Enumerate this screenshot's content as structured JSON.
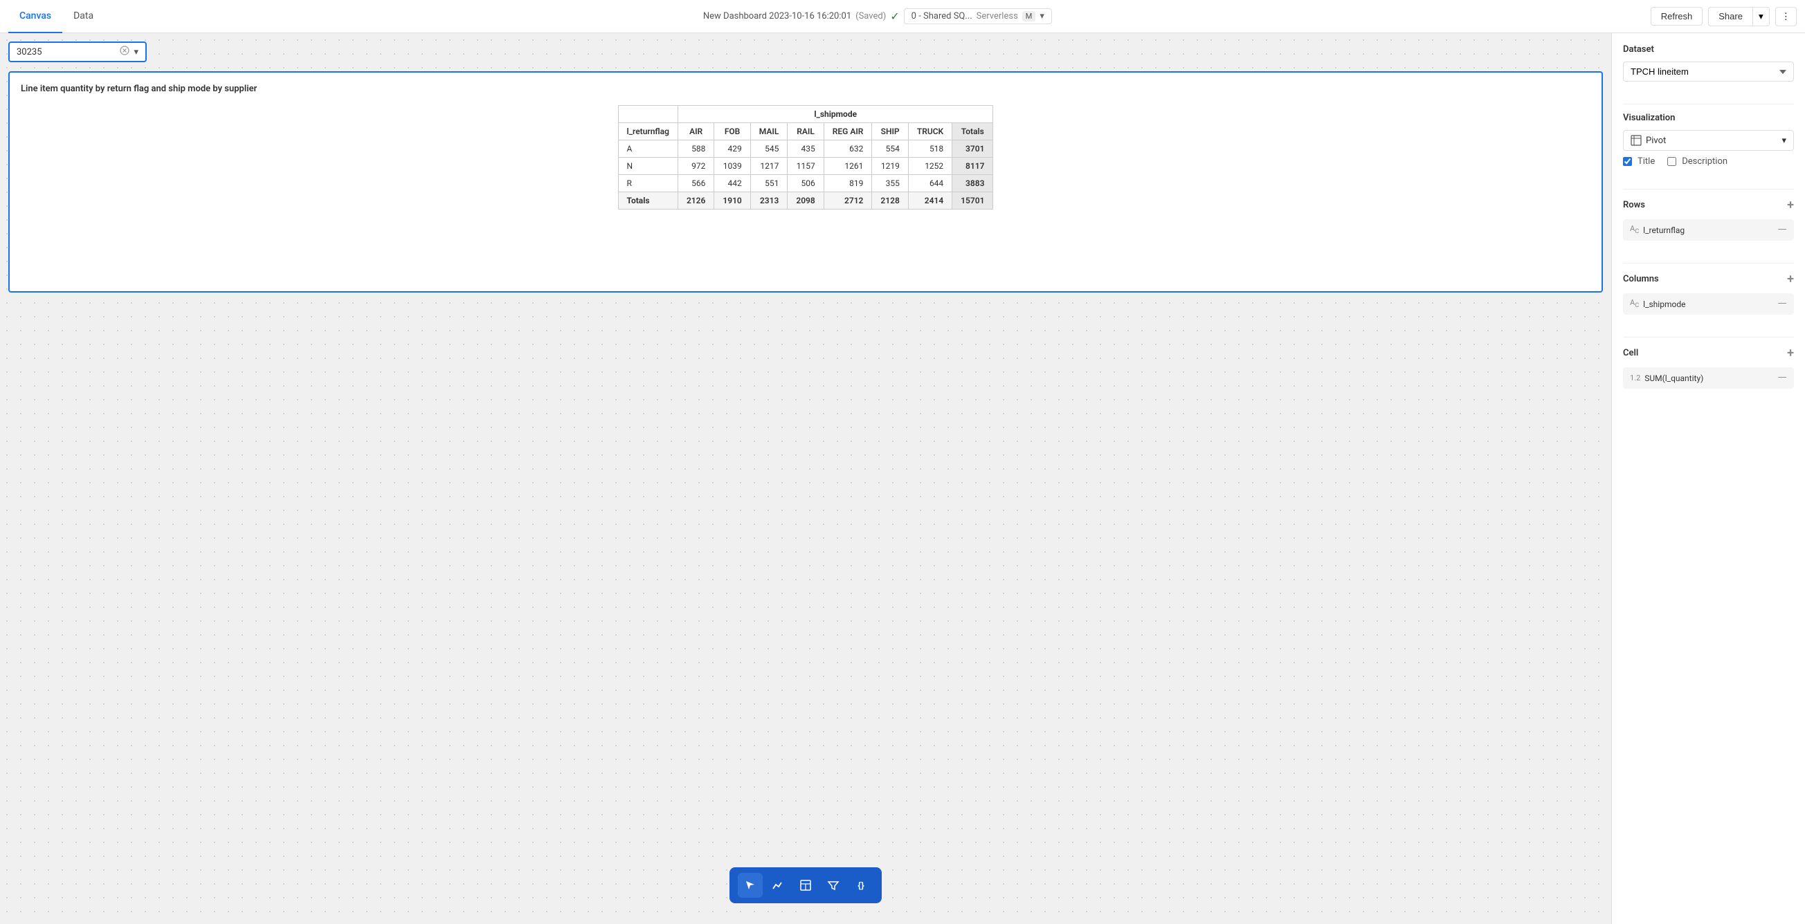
{
  "topbar": {
    "tabs": [
      {
        "id": "canvas",
        "label": "Canvas",
        "active": true
      },
      {
        "id": "data",
        "label": "Data",
        "active": false
      }
    ],
    "title": "New Dashboard 2023-10-16 16:20:01",
    "saved_status": "(Saved)",
    "db_name": "0 - Shared SQ...",
    "db_type": "Serverless",
    "db_size": "M",
    "refresh_label": "Refresh",
    "share_label": "Share",
    "more_icon": "⋮"
  },
  "filter": {
    "tag_value": "30235",
    "clear_icon": "✕",
    "dropdown_icon": "▾"
  },
  "chart": {
    "title": "Line item quantity by return flag and ship mode by supplier",
    "table": {
      "column_header": "l_shipmode",
      "row_header": "l_returnflag",
      "columns": [
        "AIR",
        "FOB",
        "MAIL",
        "RAIL",
        "REG AIR",
        "SHIP",
        "TRUCK",
        "Totals"
      ],
      "rows": [
        {
          "label": "A",
          "values": [
            588,
            429,
            545,
            435,
            632,
            554,
            518,
            3701
          ]
        },
        {
          "label": "N",
          "values": [
            972,
            1039,
            1217,
            1157,
            1261,
            1219,
            1252,
            8117
          ]
        },
        {
          "label": "R",
          "values": [
            566,
            442,
            551,
            506,
            819,
            355,
            644,
            3883
          ]
        },
        {
          "label": "Totals",
          "values": [
            2126,
            1910,
            2313,
            2098,
            2712,
            2128,
            2414,
            15701
          ],
          "is_total": true
        }
      ]
    }
  },
  "toolbar": {
    "tools": [
      {
        "id": "arrow",
        "icon": "↗",
        "active": true
      },
      {
        "id": "chart",
        "icon": "📈",
        "active": false
      },
      {
        "id": "table",
        "icon": "⊞",
        "active": false
      },
      {
        "id": "filter",
        "icon": "⧖",
        "active": false
      },
      {
        "id": "code",
        "icon": "{}",
        "active": false
      }
    ]
  },
  "panel": {
    "dataset_label": "Dataset",
    "dataset_value": "TPCH lineitem",
    "visualization_label": "Visualization",
    "visualization_value": "Pivot",
    "title_label": "Title",
    "title_checked": true,
    "description_label": "Description",
    "description_checked": false,
    "rows_label": "Rows",
    "rows_field": "l_returnflag",
    "columns_label": "Columns",
    "columns_field": "l_shipmode",
    "cell_label": "Cell",
    "cell_field": "SUM(l_quantity)",
    "cell_prefix": "1.2"
  }
}
